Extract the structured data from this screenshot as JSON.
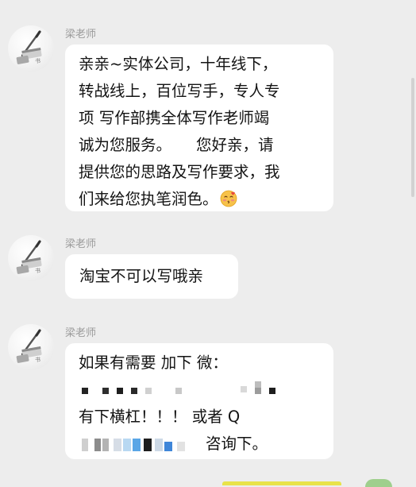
{
  "chat": {
    "messages": [
      {
        "sender": "梁老师",
        "lines": [
          "亲亲~实体公司，十年线下，",
          "转战线上，百位写手，专人专",
          "项 写作部携全体写作老师竭",
          "诚为您服务。     您好亲，请",
          "提供您的思路及写作要求，我",
          "们来给您执笔润色。"
        ],
        "emoji": "blushing-kiss-emoji"
      },
      {
        "sender": "梁老师",
        "lines": [
          "淘宝不可以写哦亲"
        ]
      },
      {
        "sender": "梁老师",
        "lines": [
          "如果有需要 加下 微：",
          "",
          "有下横杠！！！ 或者 Q",
          "咨询下。"
        ]
      }
    ]
  },
  "colors": {
    "background": "#ededed",
    "bubble": "#ffffff",
    "sender_name": "#9a9a9a",
    "text": "#141414"
  },
  "icons": {
    "avatar": "calligraphy-brush-avatar-icon",
    "emoji": "blushing-kiss-emoji"
  }
}
